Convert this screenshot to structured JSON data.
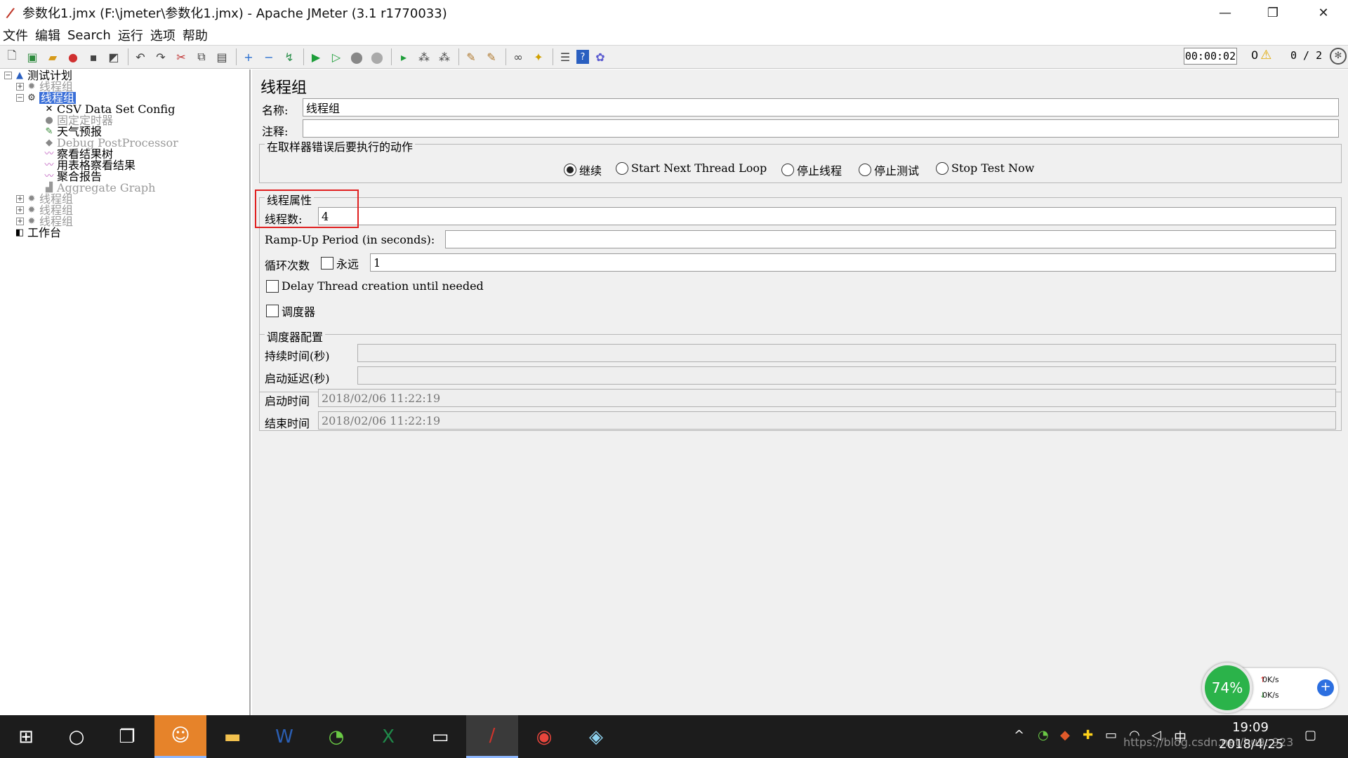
{
  "window": {
    "title": "参数化1.jmx (F:\\jmeter\\参数化1.jmx) - Apache JMeter (3.1 r1770033)",
    "minimize": "—",
    "maximize": "❐",
    "close": "✕"
  },
  "menu": [
    "文件",
    "编辑",
    "Search",
    "运行",
    "选项",
    "帮助"
  ],
  "toolbar_status": {
    "timer": "00:00:02",
    "error_count": "0",
    "threads": "0 / 2"
  },
  "tree": {
    "root": "测试计划",
    "group1": "线程组",
    "group2_selected": "线程组",
    "children": [
      {
        "label": "CSV Data Set Config",
        "dim": false
      },
      {
        "label": "固定定时器",
        "dim": true
      },
      {
        "label": "天气预报",
        "dim": false
      },
      {
        "label": "Debug PostProcessor",
        "dim": true
      },
      {
        "label": "察看结果树",
        "dim": false
      },
      {
        "label": "用表格察看结果",
        "dim": false
      },
      {
        "label": "聚合报告",
        "dim": false
      },
      {
        "label": "Aggregate Graph",
        "dim": true
      }
    ],
    "group3": "线程组",
    "group4": "线程组",
    "group5": "线程组",
    "workbench": "工作台"
  },
  "panel": {
    "title": "线程组",
    "name_label": "名称:",
    "name_value": "线程组",
    "comment_label": "注释:",
    "comment_value": "",
    "on_error_legend": "在取样器错误后要执行的动作",
    "on_error_options": [
      {
        "label": "继续",
        "selected": true
      },
      {
        "label": "Start Next Thread Loop",
        "selected": false
      },
      {
        "label": "停止线程",
        "selected": false
      },
      {
        "label": "停止测试",
        "selected": false
      },
      {
        "label": "Stop Test Now",
        "selected": false
      }
    ],
    "thread_props_legend": "线程属性",
    "threads_label": "线程数:",
    "threads_value": "4",
    "rampup_label": "Ramp-Up Period (in seconds):",
    "rampup_value": "",
    "loop_label": "循环次数",
    "forever_label": "永远",
    "forever_checked": false,
    "loop_value": "1",
    "delay_label": "Delay Thread creation until needed",
    "delay_checked": false,
    "scheduler_label": "调度器",
    "scheduler_checked": false,
    "scheduler_legend": "调度器配置",
    "duration_label": "持续时间(秒)",
    "duration_value": "",
    "startup_delay_label": "启动延迟(秒)",
    "startup_delay_value": "",
    "start_time_label": "启动时间",
    "start_time_value": "2018/02/06 11:22:19",
    "end_time_label": "结束时间",
    "end_time_value": "2018/02/06 11:22:19"
  },
  "net_widget": {
    "percent": "74%",
    "up": "0K/s",
    "down": "0K/s"
  },
  "taskbar": {
    "time": "19:09",
    "date": "2018/4/25",
    "ime": "中"
  },
  "watermark": "https://blog.csdn.net/hu9..923",
  "colors": {
    "selection": "#3a6fd8",
    "highlight_box": "#e02020",
    "net_ring": "#2bb34a"
  }
}
